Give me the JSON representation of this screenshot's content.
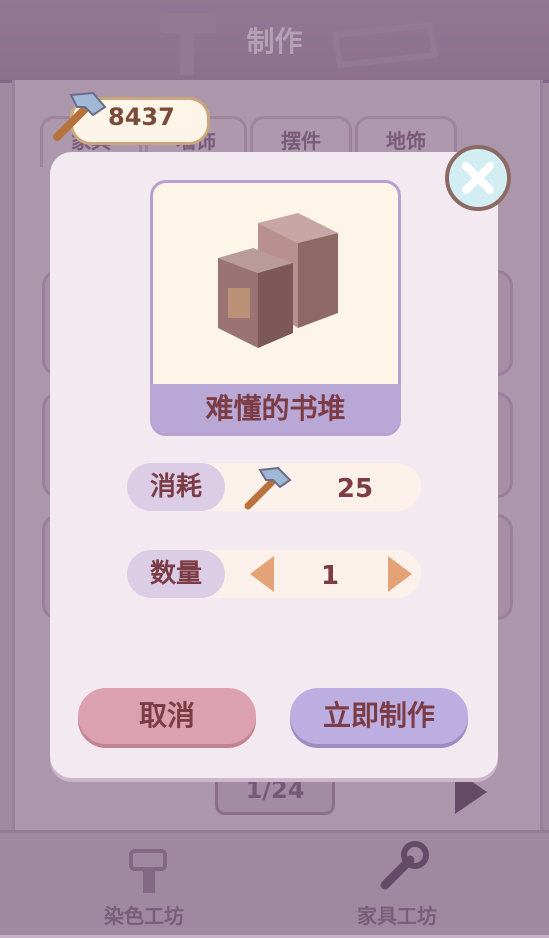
{
  "header": {
    "title": "制作"
  },
  "currency": {
    "icon": "hammer-icon",
    "value": "8437"
  },
  "tabs": [
    {
      "label": "家具"
    },
    {
      "label": "墙饰"
    },
    {
      "label": "摆件"
    },
    {
      "label": "地饰"
    }
  ],
  "pagination": {
    "label": "1/24"
  },
  "bottom_nav": [
    {
      "label": "染色工坊",
      "icon": "paint-brush-icon"
    },
    {
      "label": "家具工坊",
      "icon": "wrench-icon"
    }
  ],
  "dialog": {
    "item": {
      "name": "难懂的书堆",
      "icon": "book-stack-icon"
    },
    "cost": {
      "label": "消耗",
      "icon": "hammer-icon",
      "value": "25"
    },
    "quantity": {
      "label": "数量",
      "value": "1"
    },
    "cancel_label": "取消",
    "confirm_label": "立即制作"
  },
  "colors": {
    "accent_text": "#7c3c45",
    "dialog_bg": "#f3e9f1",
    "cancel": "#dca1b0",
    "confirm": "#bcaee0"
  }
}
